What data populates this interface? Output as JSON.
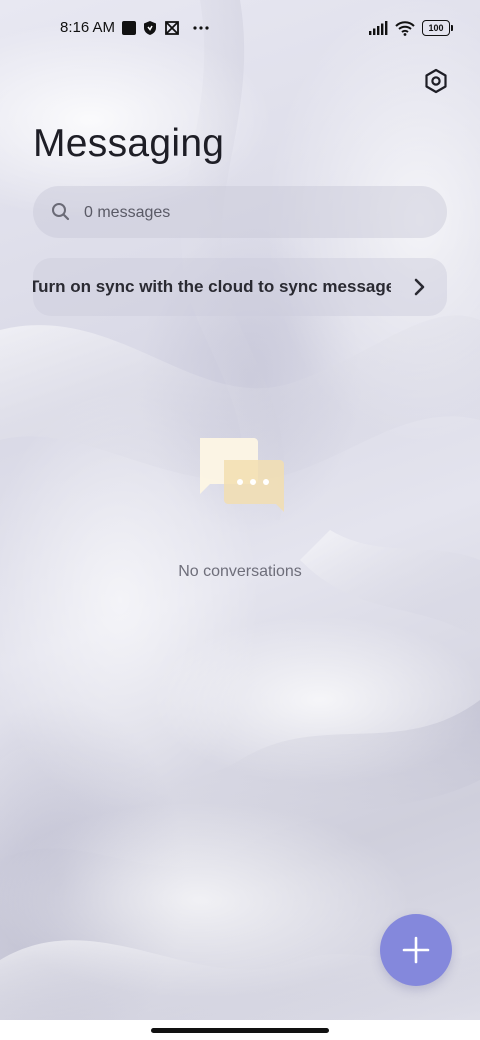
{
  "status_bar": {
    "time": "8:16 AM",
    "battery": "100",
    "icons": [
      "notification-square-icon",
      "shield-icon",
      "app-icon",
      "more-dots-icon",
      "signal-icon",
      "wifi-icon",
      "battery-icon"
    ]
  },
  "header": {
    "title": "Messaging",
    "settings_icon": "settings-hexagon-icon"
  },
  "search": {
    "placeholder": "0 messages"
  },
  "sync_banner": {
    "text": "Turn on sync with the cloud to sync messages"
  },
  "empty_state": {
    "text": "No conversations",
    "icon": "chat-bubbles-icon"
  },
  "fab": {
    "icon": "plus-icon",
    "color": "#8488dc"
  }
}
